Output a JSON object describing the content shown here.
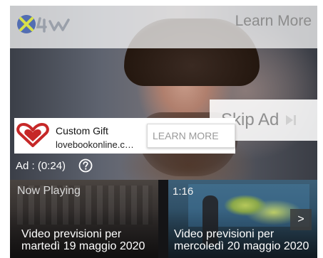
{
  "top_bar": {
    "learn_more": "Learn More"
  },
  "skip": {
    "label": "Skip Ad"
  },
  "ad": {
    "title": "Custom Gift",
    "url": "lovebookonline.c…",
    "cta": "LEARN MORE",
    "timer": "Ad : (0:24)"
  },
  "related": {
    "items": [
      {
        "badge": "Now Playing",
        "title": "Video previsioni per martedì 19 maggio 2020"
      },
      {
        "badge": "1:16",
        "title": "Video previsioni per mercoledì 20 maggio 2020"
      }
    ],
    "next": ">"
  },
  "colors": {
    "brand_blue": "#2b4fa8",
    "accent_red": "#c62828"
  }
}
